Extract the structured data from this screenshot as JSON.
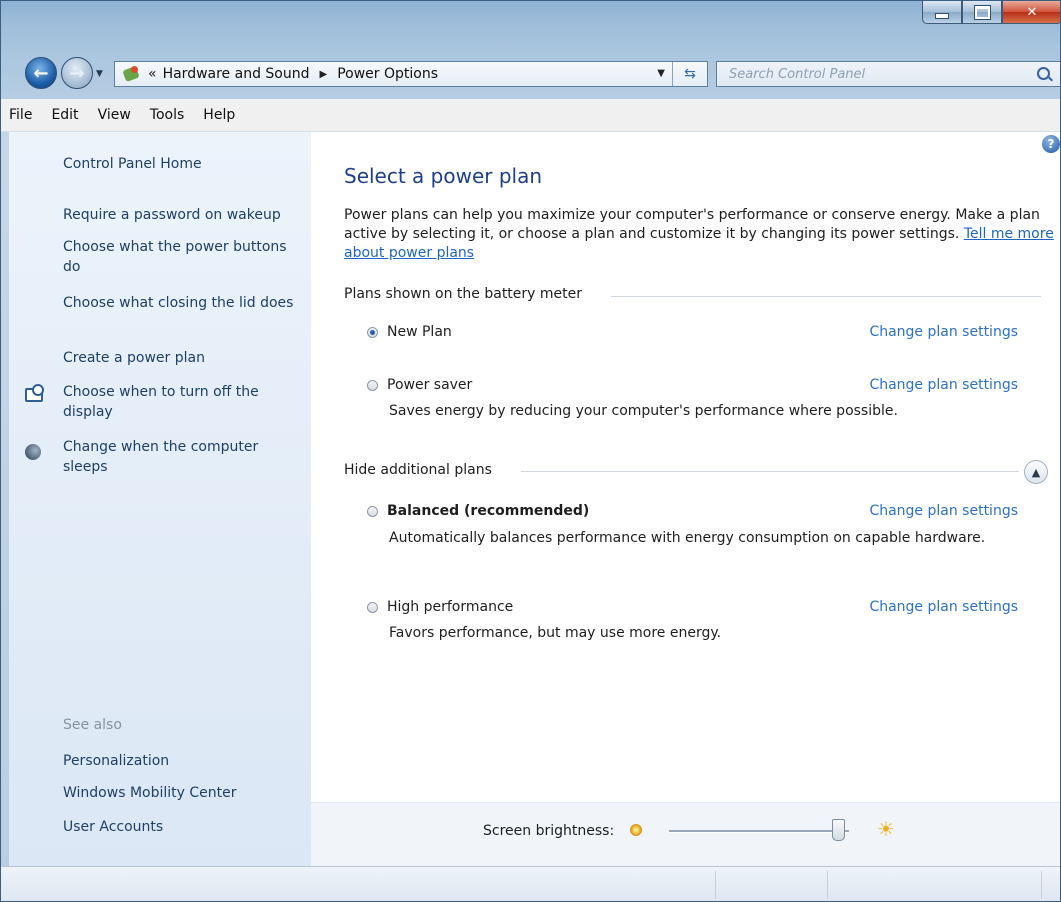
{
  "window": {
    "title_controls": {
      "minimize": "minimize-icon",
      "maximize": "maximize-icon",
      "close": "close-icon"
    }
  },
  "address": {
    "sep": "«",
    "crumbs": [
      "Hardware and Sound",
      "Power Options"
    ],
    "search_placeholder": "Search Control Panel"
  },
  "menu": [
    "File",
    "Edit",
    "View",
    "Tools",
    "Help"
  ],
  "sidebar": {
    "home": "Control Panel Home",
    "links": [
      "Require a password on wakeup",
      "Choose what the power buttons do",
      "Choose what closing the lid does",
      "Create a power plan",
      "Choose when to turn off the display",
      "Change when the computer sleeps"
    ],
    "see_also_label": "See also",
    "see_also": [
      "Personalization",
      "Windows Mobility Center",
      "User Accounts"
    ]
  },
  "main": {
    "title": "Select a power plan",
    "intro": "Power plans can help you maximize your computer's performance or conserve energy. Make a plan active by selecting it, or choose a plan and customize it by changing its power settings.",
    "intro_link": "Tell me more about power plans",
    "group1": "Plans shown on the battery meter",
    "group2": "Hide additional plans",
    "change_label": "Change plan settings",
    "plans": [
      {
        "name": "New Plan",
        "selected": true,
        "desc": ""
      },
      {
        "name": "Power saver",
        "selected": false,
        "desc": "Saves energy by reducing your computer's performance where possible."
      },
      {
        "name": "Balanced (recommended)",
        "selected": false,
        "desc": "Automatically balances performance with energy consumption on capable hardware."
      },
      {
        "name": "High performance",
        "selected": false,
        "desc": "Favors performance, but may use more energy."
      }
    ]
  },
  "footer": {
    "brightness_label": "Screen brightness:",
    "brightness_level": 0.94
  }
}
